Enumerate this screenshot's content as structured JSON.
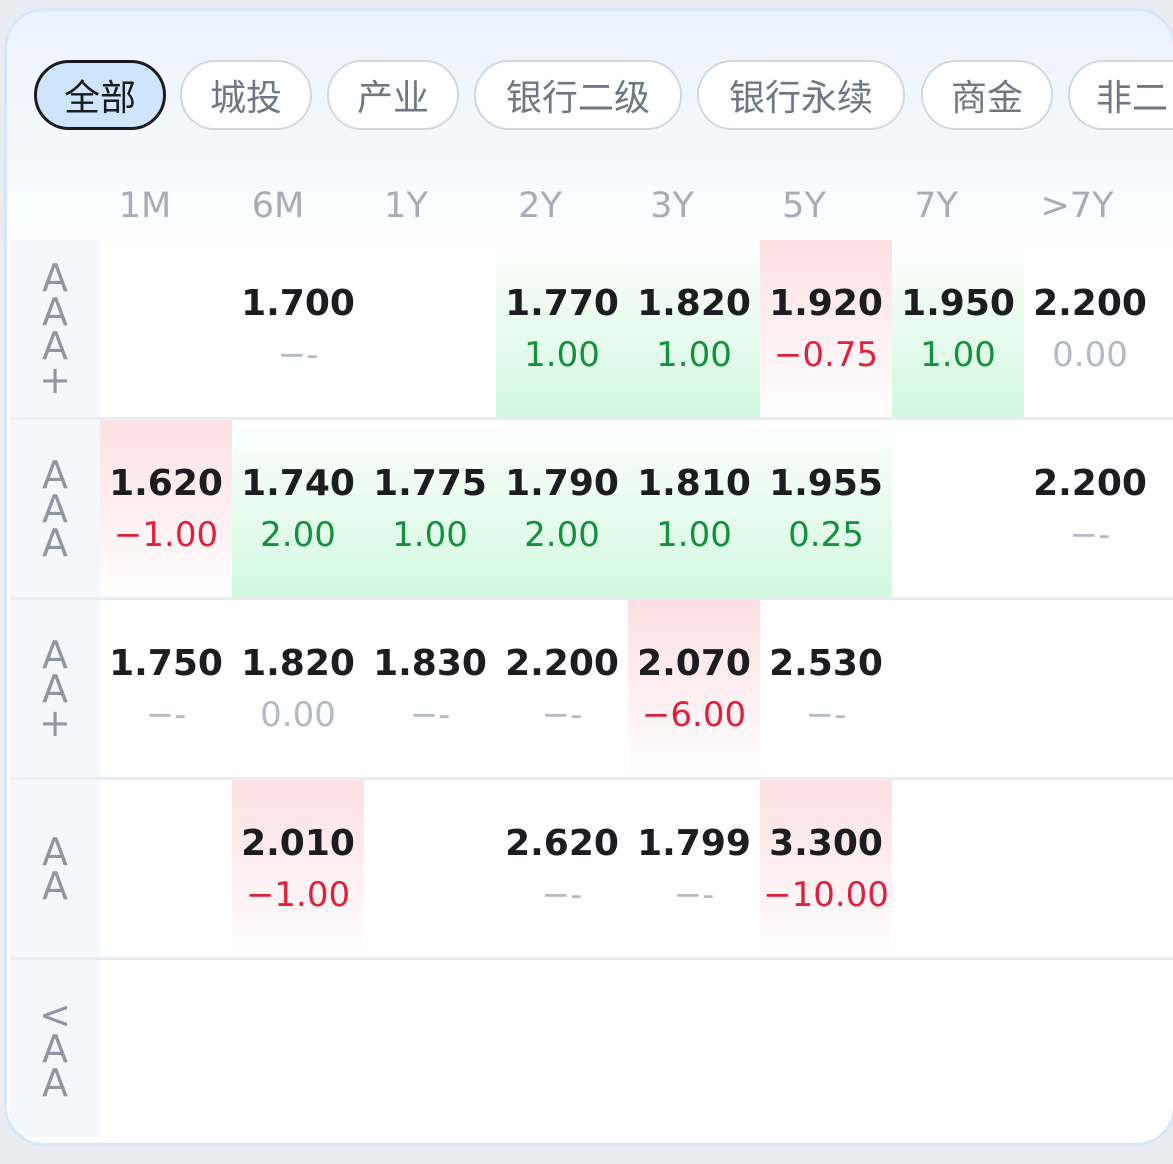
{
  "tabs": [
    "全部",
    "城投",
    "产业",
    "银行二级",
    "银行永续",
    "商金",
    "非二"
  ],
  "terms": [
    "1M",
    "6M",
    "1Y",
    "2Y",
    "3Y",
    "5Y",
    "7Y",
    ">7Y"
  ],
  "rows": [
    {
      "rating": "AAA+",
      "cells": [
        null,
        {
          "value": "1.700",
          "change": "--",
          "tone": "none",
          "bg": "none"
        },
        null,
        {
          "value": "1.770",
          "change": "1.00",
          "tone": "pos",
          "bg": "up"
        },
        {
          "value": "1.820",
          "change": "1.00",
          "tone": "pos",
          "bg": "up"
        },
        {
          "value": "1.920",
          "change": "-0.75",
          "tone": "neg",
          "bg": "down"
        },
        {
          "value": "1.950",
          "change": "1.00",
          "tone": "pos",
          "bg": "up"
        },
        {
          "value": "2.200",
          "change": "0.00",
          "tone": "zero",
          "bg": "none"
        }
      ]
    },
    {
      "rating": "AAA",
      "cells": [
        {
          "value": "1.620",
          "change": "-1.00",
          "tone": "neg",
          "bg": "down"
        },
        {
          "value": "1.740",
          "change": "2.00",
          "tone": "pos",
          "bg": "up"
        },
        {
          "value": "1.775",
          "change": "1.00",
          "tone": "pos",
          "bg": "up"
        },
        {
          "value": "1.790",
          "change": "2.00",
          "tone": "pos",
          "bg": "up"
        },
        {
          "value": "1.810",
          "change": "1.00",
          "tone": "pos",
          "bg": "up"
        },
        {
          "value": "1.955",
          "change": "0.25",
          "tone": "pos",
          "bg": "up"
        },
        null,
        {
          "value": "2.200",
          "change": "--",
          "tone": "none",
          "bg": "none"
        }
      ]
    },
    {
      "rating": "AA+",
      "cells": [
        {
          "value": "1.750",
          "change": "--",
          "tone": "none",
          "bg": "none"
        },
        {
          "value": "1.820",
          "change": "0.00",
          "tone": "zero",
          "bg": "none"
        },
        {
          "value": "1.830",
          "change": "--",
          "tone": "none",
          "bg": "none"
        },
        {
          "value": "2.200",
          "change": "--",
          "tone": "none",
          "bg": "none"
        },
        {
          "value": "2.070",
          "change": "-6.00",
          "tone": "neg",
          "bg": "down"
        },
        {
          "value": "2.530",
          "change": "--",
          "tone": "none",
          "bg": "none"
        },
        null,
        null
      ]
    },
    {
      "rating": "AA",
      "cells": [
        null,
        {
          "value": "2.010",
          "change": "-1.00",
          "tone": "neg",
          "bg": "down"
        },
        null,
        {
          "value": "2.620",
          "change": "--",
          "tone": "none",
          "bg": "none"
        },
        {
          "value": "1.799",
          "change": "--",
          "tone": "none",
          "bg": "none"
        },
        {
          "value": "3.300",
          "change": "-10.00",
          "tone": "neg",
          "bg": "down"
        },
        null,
        null
      ]
    },
    {
      "rating": "<AA",
      "cells": [
        null,
        null,
        null,
        null,
        null,
        null,
        null,
        null
      ]
    }
  ]
}
